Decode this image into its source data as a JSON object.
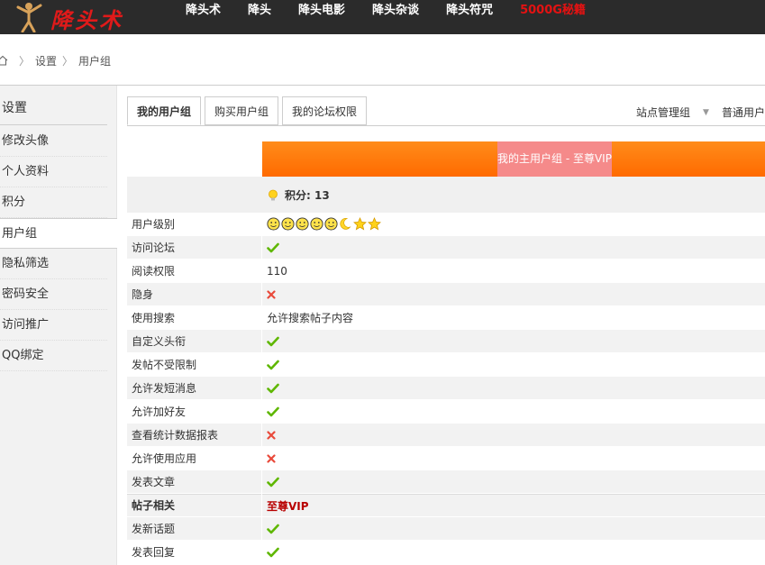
{
  "header": {
    "logo_text": "降头术",
    "nav": [
      {
        "label": "降头术",
        "hot": false
      },
      {
        "label": "降头",
        "hot": false
      },
      {
        "label": "降头电影",
        "hot": false
      },
      {
        "label": "降头杂谈",
        "hot": false
      },
      {
        "label": "降头符咒",
        "hot": false
      },
      {
        "label": "5000G秘籍",
        "hot": true
      }
    ]
  },
  "breadcrumb": {
    "items": [
      "设置",
      "用户组"
    ]
  },
  "sidebar": {
    "title": "设置",
    "items": [
      {
        "label": "修改头像",
        "active": false
      },
      {
        "label": "个人资料",
        "active": false
      },
      {
        "label": "积分",
        "active": false
      },
      {
        "label": "用户组",
        "active": true
      },
      {
        "label": "隐私筛选",
        "active": false
      },
      {
        "label": "密码安全",
        "active": false
      },
      {
        "label": "访问推广",
        "active": false
      },
      {
        "label": "QQ绑定",
        "active": false
      }
    ]
  },
  "tabs": [
    {
      "label": "我的用户组",
      "active": true
    },
    {
      "label": "购买用户组",
      "active": false
    },
    {
      "label": "我的论坛权限",
      "active": false
    }
  ],
  "group_switch": {
    "admin_label": "站点管理组",
    "normal_label": "普通用户"
  },
  "banner": {
    "label": "我的主用户组 - 至尊VIP"
  },
  "points": {
    "label": "积分: 13"
  },
  "permissions": [
    {
      "key": "用户级别",
      "type": "level",
      "value": ""
    },
    {
      "key": "访问论坛",
      "type": "check",
      "value": ""
    },
    {
      "key": "阅读权限",
      "type": "text",
      "value": "110"
    },
    {
      "key": "隐身",
      "type": "cross",
      "value": ""
    },
    {
      "key": "使用搜索",
      "type": "text",
      "value": "允许搜索帖子内容"
    },
    {
      "key": "自定义头衔",
      "type": "check",
      "value": ""
    },
    {
      "key": "发帖不受限制",
      "type": "check",
      "value": ""
    },
    {
      "key": "允许发短消息",
      "type": "check",
      "value": ""
    },
    {
      "key": "允许加好友",
      "type": "check",
      "value": ""
    },
    {
      "key": "查看统计数据报表",
      "type": "cross",
      "value": ""
    },
    {
      "key": "允许使用应用",
      "type": "cross",
      "value": ""
    },
    {
      "key": "发表文章",
      "type": "check",
      "value": ""
    },
    {
      "key": "帖子相关",
      "type": "section",
      "value": "至尊VIP"
    },
    {
      "key": "发新话题",
      "type": "check",
      "value": ""
    },
    {
      "key": "发表回复",
      "type": "check",
      "value": ""
    }
  ],
  "colors": {
    "check": "#5fb700",
    "cross": "#e94a3b",
    "banner": "#ff7a0a",
    "section_value": "#b80000"
  }
}
